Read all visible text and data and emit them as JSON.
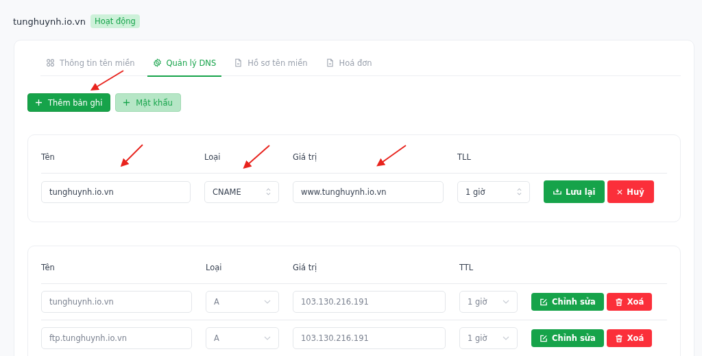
{
  "header": {
    "domain": "tunghuynh.io.vn",
    "status": "Hoạt động"
  },
  "tabs": [
    {
      "label": "Thông tin tên miền",
      "selected": false
    },
    {
      "label": "Quản lý DNS",
      "selected": true
    },
    {
      "label": "Hồ sơ tên miền",
      "selected": false
    },
    {
      "label": "Hoá đơn",
      "selected": false
    }
  ],
  "actions": [
    {
      "label": "Thêm bản ghi",
      "kind": "primary"
    },
    {
      "label": "Mật khẩu",
      "kind": "soft"
    }
  ],
  "form": {
    "columns": [
      "Tên",
      "Loại",
      "Giá trị",
      "TLL"
    ],
    "name": "tunghuynh.io.vn",
    "type": "CNAME",
    "value": "www.tunghuynh.io.vn",
    "ttl": "1 giờ",
    "save": "Lưu lại",
    "cancel": "Huỷ"
  },
  "table": {
    "columns": [
      "Tên",
      "Loại",
      "Giá trị",
      "TTL"
    ],
    "rows": [
      {
        "name": "tunghuynh.io.vn",
        "type": "A",
        "value": "103.130.216.191",
        "ttl": "1 giờ",
        "disabled": true,
        "edit": "Chỉnh sửa",
        "delete": "Xoá"
      },
      {
        "name": "ftp.tunghuynh.io.vn",
        "type": "A",
        "value": "103.130.216.191",
        "ttl": "1 giờ",
        "disabled": true,
        "edit": "Chỉnh sửa",
        "delete": "Xoá"
      }
    ]
  }
}
